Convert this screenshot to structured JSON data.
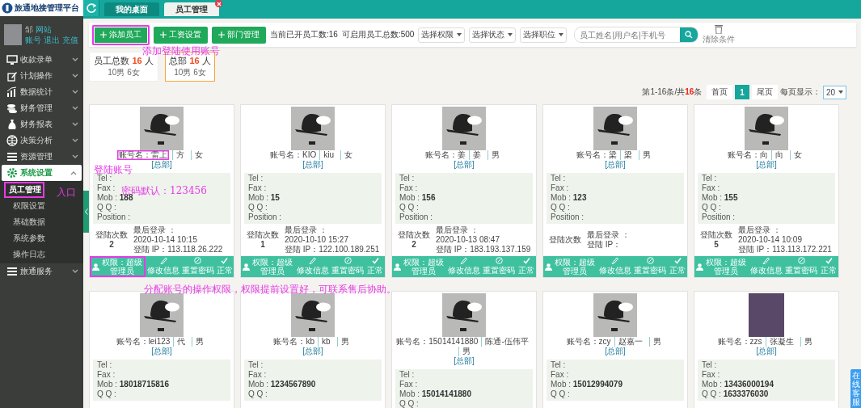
{
  "logo": {
    "title": "旅通地接管理平台"
  },
  "user": {
    "name": "邹",
    "links": [
      {
        "label": "网站"
      },
      {
        "label": "账号"
      },
      {
        "label": "退出"
      },
      {
        "label": "充值"
      }
    ]
  },
  "sidebar": {
    "items": [
      {
        "label": "收款录单",
        "expanded": false
      },
      {
        "label": "计划操作",
        "expanded": false
      },
      {
        "label": "数据统计",
        "expanded": false
      },
      {
        "label": "财务管理",
        "expanded": false
      },
      {
        "label": "财务报表",
        "expanded": false
      },
      {
        "label": "决策分析",
        "expanded": false
      },
      {
        "label": "资源管理",
        "expanded": false
      },
      {
        "label": "系统设置",
        "expanded": true,
        "children": [
          {
            "label": "员工管理",
            "selected": true,
            "highlighted": true
          },
          {
            "label": "权限设置",
            "selected": false,
            "highlighted": false
          },
          {
            "label": "基础数据",
            "selected": false,
            "highlighted": false
          },
          {
            "label": "系统参数",
            "selected": false,
            "highlighted": false
          },
          {
            "label": "操作日志",
            "selected": false,
            "highlighted": false
          }
        ]
      },
      {
        "label": "旅通服务",
        "expanded": false
      }
    ]
  },
  "tabs": [
    {
      "label": "我的桌面",
      "selected": false,
      "closable": false
    },
    {
      "label": "员工管理",
      "selected": true,
      "closable": true
    }
  ],
  "toolbar": {
    "buttons": [
      {
        "label": "添加员工",
        "highlighted": true
      },
      {
        "label": "工资设置",
        "highlighted": false
      },
      {
        "label": "部门管理",
        "highlighted": false
      }
    ],
    "stats": [
      "当前已开员工数:16",
      "可启用员工总数:500"
    ],
    "filters": [
      "选择权限",
      "选择状态",
      "选择职位"
    ],
    "search": {
      "placeholder": "员工姓名|用户名|手机号"
    },
    "clear": "清除条件"
  },
  "summary": [
    {
      "label": "员工总数",
      "count": "16",
      "unit": "人",
      "detail": "10男 6女",
      "selected": false
    },
    {
      "label": "总部",
      "count": "16",
      "unit": "人",
      "detail": "10男 6女",
      "selected": true
    }
  ],
  "pagination": {
    "range": "第1-16条/共",
    "total": "16",
    "suffix": "条",
    "pages": [
      {
        "label": "首页",
        "selected": false
      },
      {
        "label": "1",
        "selected": true
      },
      {
        "label": "尾页",
        "selected": false
      }
    ],
    "per_page_label": "每页显示：",
    "per_page": "20"
  },
  "employees": [
    {
      "kind": "drawing",
      "account": "账号名：雷上",
      "account_highlighted": true,
      "name": "方",
      "gender": "女",
      "department": "[总部]",
      "fields": [
        {
          "label": "Tel :"
        },
        {
          "label": "Fax :"
        },
        {
          "label": "Mob :",
          "value": "188"
        },
        {
          "label": "Q Q :"
        },
        {
          "label": "Position :"
        }
      ],
      "login": {
        "count_label": "登陆次数",
        "count": "2",
        "last_label": "最后登录 ：",
        "last": "2020-10-14 10:15",
        "ip_label": "登陆 IP：",
        "ip": "113.118.26.222"
      },
      "role": "权限：超级管理员",
      "role_highlighted": true,
      "actions": [
        "修改信息",
        "重置密码"
      ],
      "status": "正常"
    },
    {
      "kind": "drawing",
      "account": "账号名：KIO",
      "account_highlighted": false,
      "name": "kiu",
      "gender": "女",
      "department": "[总部]",
      "fields": [
        {
          "label": "Tel :"
        },
        {
          "label": "Fax :"
        },
        {
          "label": "Mob :",
          "value": "15"
        },
        {
          "label": "Q Q :"
        },
        {
          "label": "Position :"
        }
      ],
      "login": {
        "count_label": "登陆次数",
        "count": "1",
        "last_label": "最后登录 ：",
        "last": "2020-10-10 15:27",
        "ip_label": "登陆 IP：",
        "ip": "122.100.189.251"
      },
      "role": "权限：超级管理员",
      "role_highlighted": false,
      "actions": [
        "修改信息",
        "重置密码"
      ],
      "status": "正常"
    },
    {
      "kind": "drawing",
      "account": "账号名：姜",
      "account_highlighted": false,
      "name": "姜",
      "gender": "男",
      "department": "[总部]",
      "fields": [
        {
          "label": "Tel :"
        },
        {
          "label": "Fax :"
        },
        {
          "label": "Mob :",
          "value": "156"
        },
        {
          "label": "Q Q :"
        },
        {
          "label": "Position :"
        }
      ],
      "login": {
        "count_label": "登陆次数",
        "count": "2",
        "last_label": "最后登录 ：",
        "last": "2020-10-13 08:47",
        "ip_label": "登陆 IP：",
        "ip": "183.193.137.159"
      },
      "role": "权限：超级管理员",
      "role_highlighted": false,
      "actions": [
        "修改信息",
        "重置密码"
      ],
      "status": "正常"
    },
    {
      "kind": "drawing",
      "account": "账号名：梁",
      "account_highlighted": false,
      "name": "梁",
      "gender": "男",
      "department": "[总部]",
      "fields": [
        {
          "label": "Tel :"
        },
        {
          "label": "Fax :"
        },
        {
          "label": "Mob :",
          "value": "123"
        },
        {
          "label": "Q Q :"
        },
        {
          "label": "Position :"
        }
      ],
      "login": {
        "count_label": "登陆次数",
        "last_label": "最后登录 ：",
        "ip_label": "登陆 IP："
      },
      "role": "权限：超级管理员",
      "role_highlighted": false,
      "actions": [
        "修改信息",
        "重置密码"
      ],
      "status": "正常"
    },
    {
      "kind": "drawing",
      "account": "账号名：向",
      "account_highlighted": false,
      "name": "向",
      "gender": "女",
      "department": "[总部]",
      "fields": [
        {
          "label": "Tel :"
        },
        {
          "label": "Fax :"
        },
        {
          "label": "Mob :",
          "value": "155"
        },
        {
          "label": "Q Q :"
        },
        {
          "label": "Position :"
        }
      ],
      "login": {
        "count_label": "登陆次数",
        "count": "5",
        "last_label": "最后登录 ：",
        "last": "2020-10-14 10:09",
        "ip_label": "登陆 IP：",
        "ip": "113.113.172.221"
      },
      "role": "权限：超级管理员",
      "role_highlighted": false,
      "actions": [
        "修改信息",
        "重置密码"
      ],
      "status": "正常"
    },
    {
      "kind": "drawing",
      "account": "账号名：lei123",
      "account_highlighted": false,
      "name": "代",
      "gender": "男",
      "department": "[总部]",
      "fields": [
        {
          "label": "Tel :"
        },
        {
          "label": "Fax :"
        },
        {
          "label": "Mob :",
          "value": "18018715816"
        },
        {
          "label": "Q Q :"
        }
      ]
    },
    {
      "kind": "drawing",
      "account": "账号名：kb",
      "account_highlighted": false,
      "name": "kb",
      "gender": "男",
      "department": "[总部]",
      "fields": [
        {
          "label": "Tel :"
        },
        {
          "label": "Fax :"
        },
        {
          "label": "Mob :",
          "value": "1234567890"
        },
        {
          "label": "Q Q :"
        }
      ]
    },
    {
      "kind": "drawing",
      "account": "账号名：15014141880",
      "account_highlighted": false,
      "name": "陈通-伍伟平",
      "gender": "男",
      "department": "[总部]",
      "fields": [
        {
          "label": "Tel :"
        },
        {
          "label": "Fax :"
        },
        {
          "label": "Mob :",
          "value": "15014141880"
        },
        {
          "label": "Q Q :"
        }
      ]
    },
    {
      "kind": "drawing",
      "account": "账号名：zcy",
      "account_highlighted": false,
      "name": "赵嘉一",
      "gender": "男",
      "department": "[总部]",
      "fields": [
        {
          "label": "Tel :"
        },
        {
          "label": "Fax :"
        },
        {
          "label": "Mob :",
          "value": "15012994079"
        },
        {
          "label": "Q Q :"
        }
      ]
    },
    {
      "kind": "photo",
      "account": "账号名：zzs",
      "account_highlighted": false,
      "name": "张凝生",
      "gender": "男",
      "department": "[总部]",
      "fields": [
        {
          "label": "Tel :"
        },
        {
          "label": "Fax :"
        },
        {
          "label": "Mob :",
          "value": "13436000194"
        },
        {
          "label": "Q Q :",
          "value": "1633376030"
        }
      ]
    }
  ],
  "annotations": [
    "添加登陆使用账号",
    "入口",
    "登陆账号",
    "密码默认：123456",
    "分配账号的操作权限，权限提前设置好，可联系售后协助。"
  ],
  "online_service": "在线客服"
}
